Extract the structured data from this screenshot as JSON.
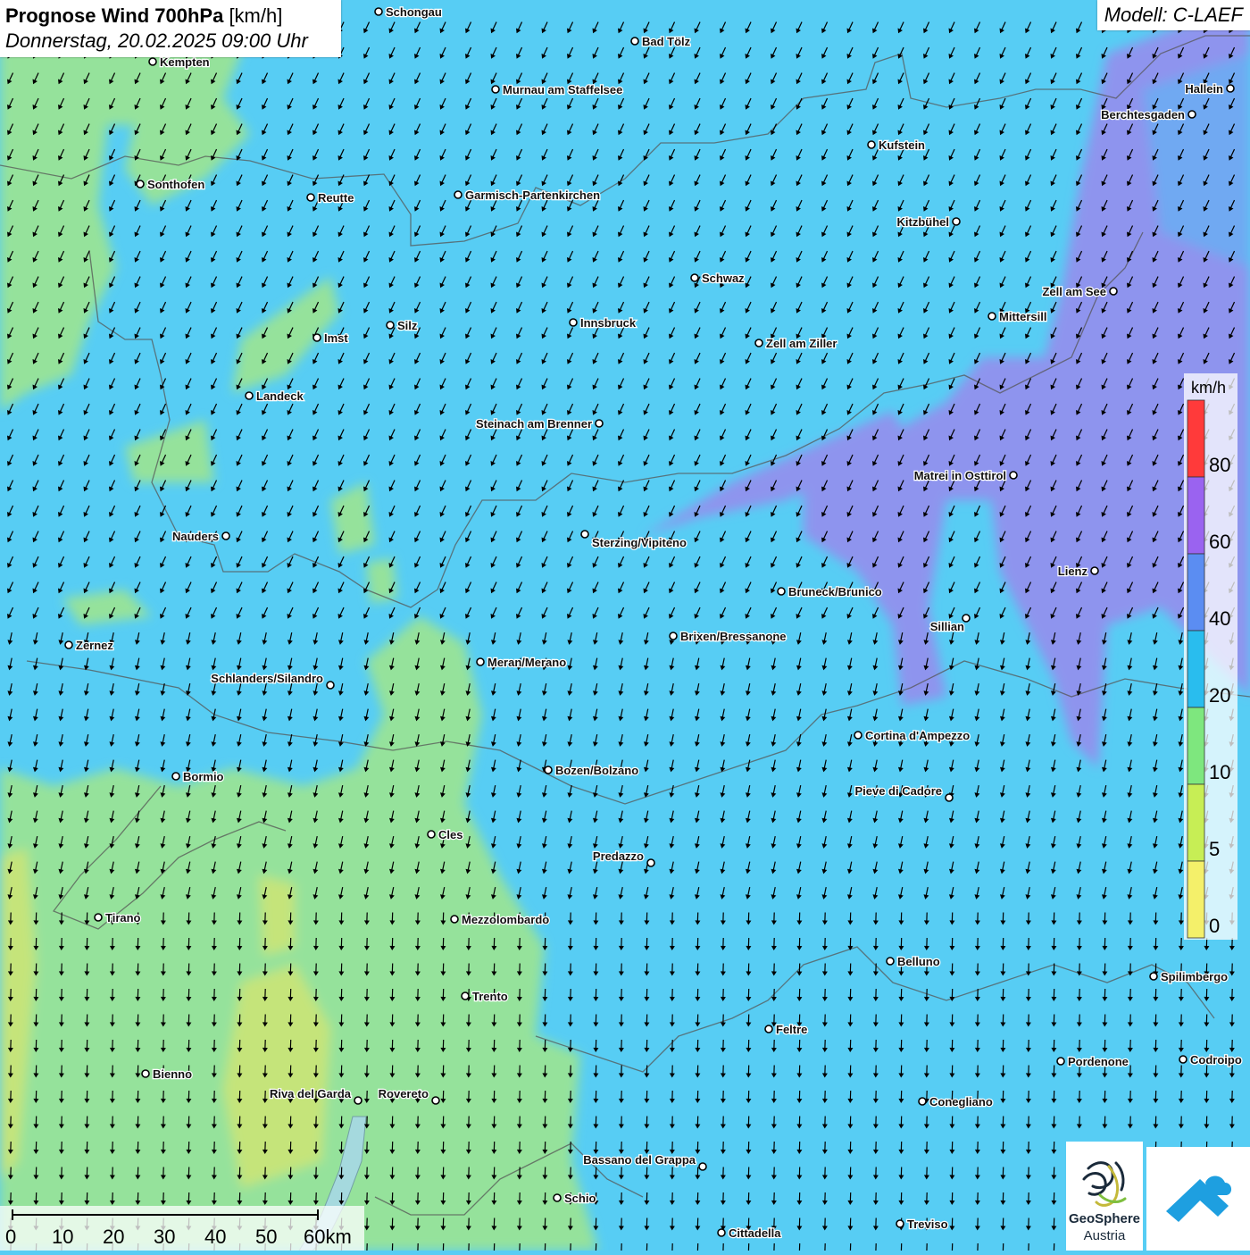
{
  "title": {
    "bold": "Prognose Wind 700hPa",
    "unit": "[km/h]",
    "datetime": "Donnerstag, 20.02.2025 09:00 Uhr"
  },
  "model": "Modell: C-LAEF",
  "legend": {
    "unit": "km/h",
    "labels": [
      "80",
      "60",
      "40",
      "20",
      "10",
      "5",
      "0"
    ],
    "colors": [
      "#ff3a3a",
      "#9a63f0",
      "#5b8df2",
      "#29bdee",
      "#7ee77e",
      "#c7ee55",
      "#f4f06a"
    ]
  },
  "scalebar": {
    "labels": [
      "0",
      "10",
      "20",
      "30",
      "40",
      "50",
      "60km"
    ]
  },
  "logos": {
    "geosphere_line1": "GeoSphere",
    "geosphere_line2": "Austria"
  },
  "field_colors": {
    "base": "#57cdf4",
    "green": "#95e29b",
    "yellow": "#c5e47a",
    "purple": "#8e94ee",
    "blue": "#6fa9f2"
  },
  "cities": [
    {
      "name": "Schongau"
    },
    {
      "name": "Bad Tölz"
    },
    {
      "name": "Kempten"
    },
    {
      "name": "Murnau am Staffelsee"
    },
    {
      "name": "Hallein"
    },
    {
      "name": "Berchtesgaden"
    },
    {
      "name": "Kufstein"
    },
    {
      "name": "Sonthofen"
    },
    {
      "name": "Reutte"
    },
    {
      "name": "Garmisch-Partenkirchen"
    },
    {
      "name": "Kitzbühel"
    },
    {
      "name": "Schwaz"
    },
    {
      "name": "Zell am See"
    },
    {
      "name": "Mittersill"
    },
    {
      "name": "Innsbruck"
    },
    {
      "name": "Silz"
    },
    {
      "name": "Imst"
    },
    {
      "name": "Zell am Ziller"
    },
    {
      "name": "Landeck"
    },
    {
      "name": "Steinach am Brenner"
    },
    {
      "name": "Matrei in Osttirol"
    },
    {
      "name": "Nauders"
    },
    {
      "name": "Sterzing/Vipiteno"
    },
    {
      "name": "Lienz"
    },
    {
      "name": "Bruneck/Brunico"
    },
    {
      "name": "Sillian"
    },
    {
      "name": "Zernez"
    },
    {
      "name": "Brixen/Bressanone"
    },
    {
      "name": "Meran/Merano"
    },
    {
      "name": "Schlanders/Silandro"
    },
    {
      "name": "Cortina d'Ampezzo"
    },
    {
      "name": "Bozen/Bolzano"
    },
    {
      "name": "Bormio"
    },
    {
      "name": "Pieve di Cadore"
    },
    {
      "name": "Cles"
    },
    {
      "name": "Predazzo"
    },
    {
      "name": "Tirano"
    },
    {
      "name": "Mezzolombardo"
    },
    {
      "name": "Belluno"
    },
    {
      "name": "Spilimbergo"
    },
    {
      "name": "Trento"
    },
    {
      "name": "Feltre"
    },
    {
      "name": "Pordenone"
    },
    {
      "name": "Codroipo"
    },
    {
      "name": "Bienno"
    },
    {
      "name": "Riva del Garda"
    },
    {
      "name": "Rovereto"
    },
    {
      "name": "Conegliano"
    },
    {
      "name": "Bassano del Grappa"
    },
    {
      "name": "Schio"
    },
    {
      "name": "Treviso"
    },
    {
      "name": "Cittadella"
    }
  ]
}
